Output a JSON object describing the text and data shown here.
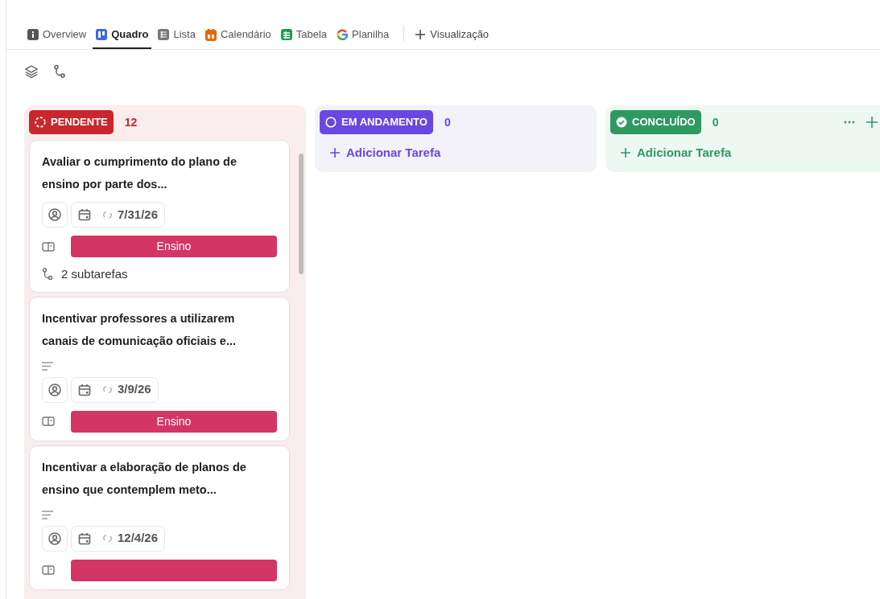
{
  "tabs": [
    {
      "label": "Overview",
      "kind": "info",
      "selected": false
    },
    {
      "label": "Quadro",
      "kind": "board",
      "selected": true
    },
    {
      "label": "Lista",
      "kind": "list",
      "selected": false
    },
    {
      "label": "Calendário",
      "kind": "calendar",
      "selected": false
    },
    {
      "label": "Tabela",
      "kind": "table",
      "selected": false
    },
    {
      "label": "Planilha",
      "kind": "sheet",
      "selected": false
    }
  ],
  "add_view": "Visualização",
  "columns": [
    {
      "status": "PENDENTE",
      "kind": "pending",
      "color": "#c8282d",
      "count": "12",
      "cards": [
        {
          "title": "Avaliar o cumprimento do plano de ensino por parte dos...",
          "has_description": false,
          "date": "7/31/26",
          "tag": {
            "label": "Ensino",
            "color": "#d33665"
          },
          "subtasks": "2 subtarefas"
        },
        {
          "title": "Incentivar professores a utilizarem canais de comunicação oficiais e...",
          "has_description": true,
          "date": "3/9/26",
          "tag": {
            "label": "Ensino",
            "color": "#d33665"
          }
        },
        {
          "title": "Incentivar a elaboração de planos de ensino que contemplem meto...",
          "has_description": true,
          "date": "12/4/26",
          "tag": {
            "color": "#d33665"
          }
        }
      ]
    },
    {
      "status": "EM ANDAMENTO",
      "kind": "progress",
      "color": "#6a47e0",
      "count": "0",
      "add_task": "Adicionar Tarefa"
    },
    {
      "status": "CONCLUÍDO",
      "kind": "done",
      "color": "#2e9a61",
      "count": "0",
      "add_task": "Adicionar Tarefa",
      "menu": true
    }
  ]
}
